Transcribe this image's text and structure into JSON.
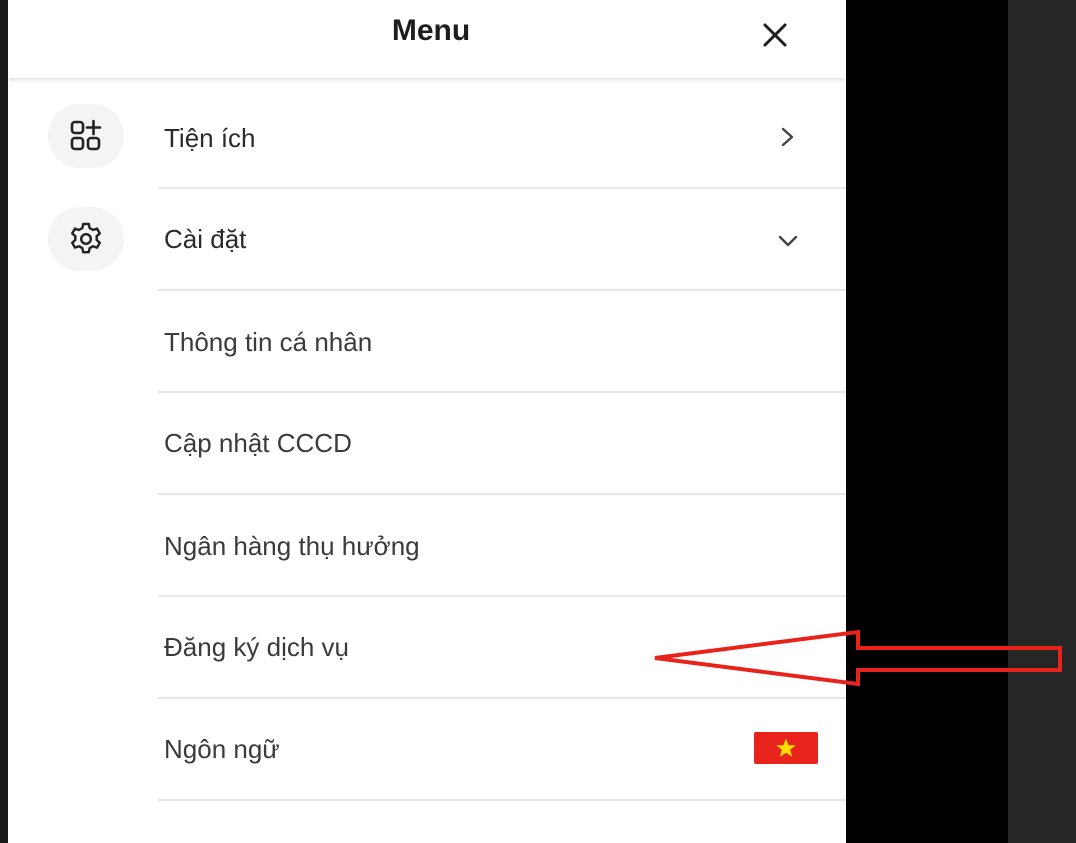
{
  "header": {
    "title": "Menu",
    "close_icon": "close-icon"
  },
  "menu": {
    "items": [
      {
        "label": "Tiện ích",
        "icon": "apps-add-icon",
        "indicator": "chevron-right-icon"
      },
      {
        "label": "Cài đặt",
        "icon": "gear-icon",
        "indicator": "chevron-down-icon"
      }
    ],
    "settings_sub": [
      {
        "label": "Thông tin cá nhân"
      },
      {
        "label": "Cập nhật CCCD"
      },
      {
        "label": "Ngân hàng thụ hưởng"
      },
      {
        "label": "Đăng ký dịch vụ"
      },
      {
        "label": "Ngôn ngữ",
        "badge_icon": "vietnam-flag-icon"
      }
    ]
  },
  "annotation": {
    "arrow_icon": "red-outline-arrow-icon",
    "color": "#e8231c"
  },
  "colors": {
    "accent_green": "#4aa05a",
    "flag_red": "#e8231c",
    "flag_star": "#ffde00"
  }
}
